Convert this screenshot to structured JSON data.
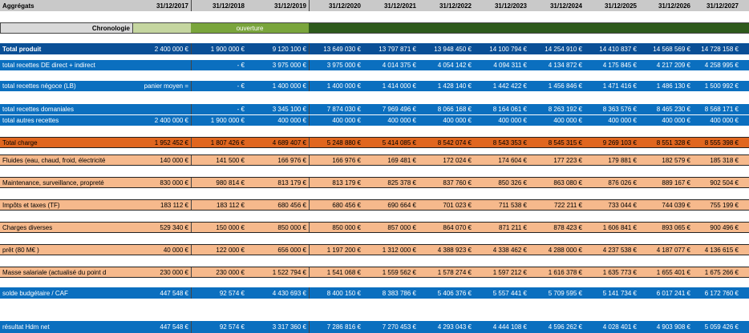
{
  "colors": {
    "header_bg": "#c9c9c9",
    "blue": "#0b6fbf",
    "dark_blue": "#0a4f96",
    "orange_dark": "#e0661f",
    "orange_light": "#f6b98c",
    "chrono_grey": "#d9d9d9",
    "chrono_green_light": "#c5d6a0",
    "chrono_green": "#7aa53c",
    "chrono_dark_green": "#2e5a1c",
    "line": "#222222"
  },
  "header": {
    "title": "Aggrégats",
    "years": [
      "31/12/2017",
      "31/12/2018",
      "31/12/2019",
      "31/12/2020",
      "31/12/2021",
      "31/12/2022",
      "31/12/2023",
      "31/12/2024",
      "31/12/2025",
      "31/12/2026",
      "31/12/2027"
    ]
  },
  "chronology": {
    "label": "Chronologie",
    "ouverture": "ouverture"
  },
  "rows": [
    {
      "label": "Total produit",
      "values": [
        "2 400 000 €",
        "1 900 000 €",
        "9 120 100 €",
        "13 649 030 €",
        "13 797 871 €",
        "13 948 450 €",
        "14 100 794 €",
        "14 254 910 €",
        "14 410 837 €",
        "14 568 569 €",
        "14 728 158 €"
      ]
    },
    {
      "label": "total recettes DE direct + indirect",
      "values": [
        "",
        "-     €",
        "3 975 000 €",
        "3 975 000 €",
        "4 014 375 €",
        "4 054 142 €",
        "4 094 311 €",
        "4 134 872 €",
        "4 175 845 €",
        "4 217 209 €",
        "4 258 995 €"
      ]
    },
    {
      "label": "total recettes négoce (LB)",
      "values": [
        "panier moyen =",
        "-     €",
        "1 400 000 €",
        "1 400 000 €",
        "1 414 000 €",
        "1 428 140 €",
        "1 442 422 €",
        "1 456 846 €",
        "1 471 416 €",
        "1 486 130 €",
        "1 500 992 €"
      ]
    },
    {
      "label": "total recettes domaniales",
      "values": [
        "",
        "-     €",
        "3 345 100 €",
        "7 874 030 €",
        "7 969 496 €",
        "8 066 168 €",
        "8 164 061 €",
        "8 263 192 €",
        "8 363 576 €",
        "8 465 230 €",
        "8 568 171 €"
      ]
    },
    {
      "label": "total autres recettes",
      "values": [
        "2 400 000 €",
        "1 900 000 €",
        "400 000 €",
        "400 000 €",
        "400 000 €",
        "400 000 €",
        "400 000 €",
        "400 000 €",
        "400 000 €",
        "400 000 €",
        "400 000 €"
      ]
    },
    {
      "label": "Total charge",
      "values": [
        "1 952 452 €",
        "1 807 426 €",
        "4 689 407 €",
        "5 248 880 €",
        "5 414 085 €",
        "8 542 074 €",
        "8 543 353 €",
        "8 545 315 €",
        "9 269 103 €",
        "8 551 328 €",
        "8 555 398 €"
      ]
    },
    {
      "label": "Fluides (eau, chaud, froid, électricité",
      "values": [
        "140 000 €",
        "141 500 €",
        "166 976 €",
        "166 976 €",
        "169 481 €",
        "172 024 €",
        "174 604 €",
        "177 223 €",
        "179 881 €",
        "182 579 €",
        "185 318 €"
      ]
    },
    {
      "label": "Maintenance, surveillance, propreté",
      "values": [
        "830 000 €",
        "980 814 €",
        "813 179 €",
        "813 179 €",
        "825 378 €",
        "837 760 €",
        "850 326 €",
        "863 080 €",
        "876 026 €",
        "889 167 €",
        "902 504 €"
      ]
    },
    {
      "label": "Impôts et taxes (TF)",
      "values": [
        "183 112 €",
        "183 112 €",
        "680 456 €",
        "680 456 €",
        "690 664 €",
        "701 023 €",
        "711 538 €",
        "722 211 €",
        "733 044 €",
        "744 039 €",
        "755 199 €"
      ]
    },
    {
      "label": "Charges diverses",
      "values": [
        "529 340 €",
        "150 000 €",
        "850 000 €",
        "850 000 €",
        "857 000 €",
        "864 070 €",
        "871 211 €",
        "878 423 €",
        "1 606 841 €",
        "893 065 €",
        "900 496 €"
      ]
    },
    {
      "label": "prêt (80 M€ )",
      "values": [
        "40 000 €",
        "122 000 €",
        "656 000 €",
        "1 197 200 €",
        "1 312 000 €",
        "4 388 923 €",
        "4 338 462 €",
        "4 288 000 €",
        "4 237 538 €",
        "4 187 077 €",
        "4 136 615 €"
      ]
    },
    {
      "label": "Masse salariale (actualisé du point d",
      "values": [
        "230 000 €",
        "230 000 €",
        "1 522 794 €",
        "1 541 068 €",
        "1 559 562 €",
        "1 578 274 €",
        "1 597 212 €",
        "1 616 378 €",
        "1 635 773 €",
        "1 655 401 €",
        "1 675 266 €"
      ]
    },
    {
      "label": "solde budgétaire / CAF",
      "values": [
        "447 548 €",
        "92 574 €",
        "4 430 693 €",
        "8 400 150 €",
        "8 383 786 €",
        "5 406 376 €",
        "5 557 441 €",
        "5 709 595 €",
        "5 141 734 €",
        "6 017 241 €",
        "6 172 760 €"
      ]
    },
    {
      "label": "résultat Hdm net",
      "values": [
        "447 548 €",
        "92 574 €",
        "3 317 360 €",
        "7 286 816 €",
        "7 270 453 €",
        "4 293 043 €",
        "4 444 108 €",
        "4 596 262 €",
        "4 028 401 €",
        "4 903 908 €",
        "5 059 426 €"
      ]
    }
  ]
}
